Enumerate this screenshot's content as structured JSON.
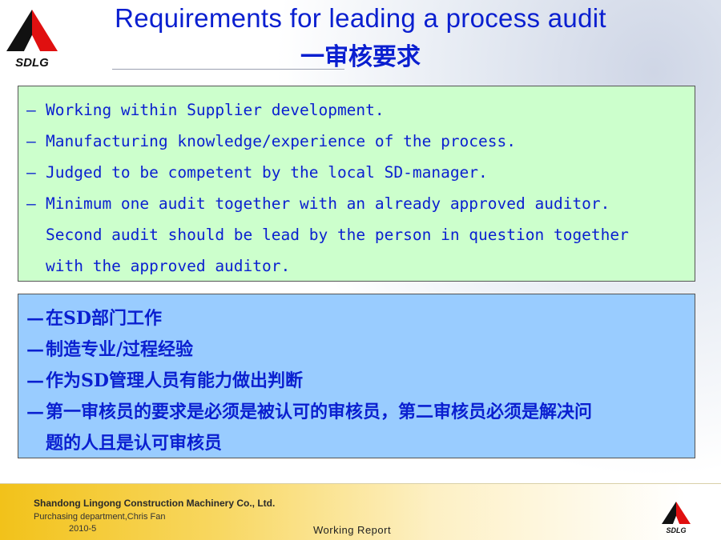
{
  "header": {
    "logo_text": "SDLG",
    "title_en": "Requirements for leading a process audit",
    "title_cn": "一审核要求"
  },
  "english_box": {
    "lines": [
      {
        "dash": "—",
        "text": "Working within Supplier development."
      },
      {
        "dash": "—",
        "text": "Manufacturing knowledge/experience of the process."
      },
      {
        "dash": "—",
        "text": "Judged to be competent by the local SD-manager."
      },
      {
        "dash": "—",
        "text": "Minimum one audit together with an already approved auditor."
      },
      {
        "dash": "",
        "text": "Second audit should be lead by the person in question together"
      },
      {
        "dash": "",
        "text": "with the approved auditor."
      }
    ]
  },
  "chinese_box": {
    "lines": [
      {
        "dash": "—",
        "text": "在SD部门工作"
      },
      {
        "dash": "—",
        "text": "制造专业/过程经验"
      },
      {
        "dash": "—",
        "text": "作为SD管理人员有能力做出判断"
      },
      {
        "dash": "—",
        "text": "第一审核员的要求是必须是被认可的审核员，第二审核员必须是解决问"
      },
      {
        "dash": "",
        "text": "题的人且是认可审核员"
      }
    ]
  },
  "footer": {
    "company": "Shandong Lingong Construction Machinery Co., Ltd.",
    "department": "Purchasing department,Chris Fan",
    "date": "2010-5",
    "report": "Working  Report",
    "logo_text": "SDLG"
  },
  "colors": {
    "title_blue": "#0a1fd0",
    "green_box": "#ccffcc",
    "blue_box": "#99ccff",
    "logo_red": "#e01010",
    "footer_yellow": "#f2c21a"
  }
}
